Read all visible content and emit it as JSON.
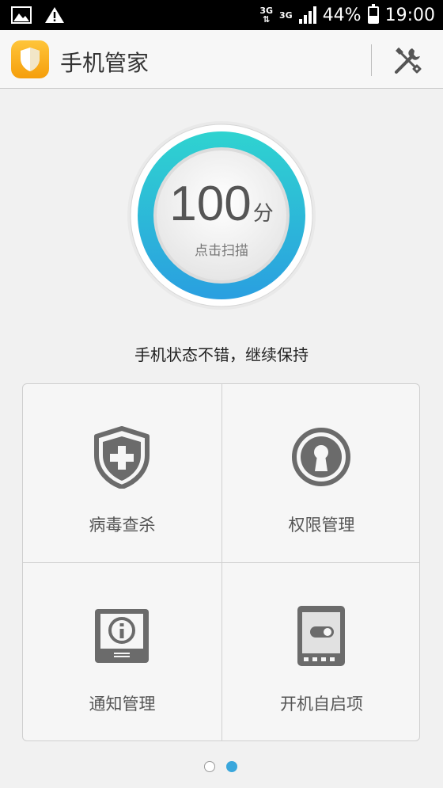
{
  "status_bar": {
    "network_1": "3G",
    "network_2": "3G",
    "battery": "44%",
    "time": "19:00"
  },
  "app_bar": {
    "title": "手机管家"
  },
  "score": {
    "value": "100",
    "unit": "分",
    "action": "点击扫描",
    "status": "手机状态不错，继续保持"
  },
  "features": [
    {
      "label": "病毒查杀",
      "icon": "shield-plus-icon"
    },
    {
      "label": "权限管理",
      "icon": "keyhole-icon"
    },
    {
      "label": "通知管理",
      "icon": "notification-info-icon"
    },
    {
      "label": "开机自启项",
      "icon": "startup-toggle-icon"
    }
  ],
  "pager": {
    "pages": 2,
    "current": 2
  },
  "colors": {
    "accent": "#3aa7dc",
    "ring_start": "#2fd3d0",
    "ring_end": "#2a9fe0",
    "logo": "#f5a70f"
  }
}
